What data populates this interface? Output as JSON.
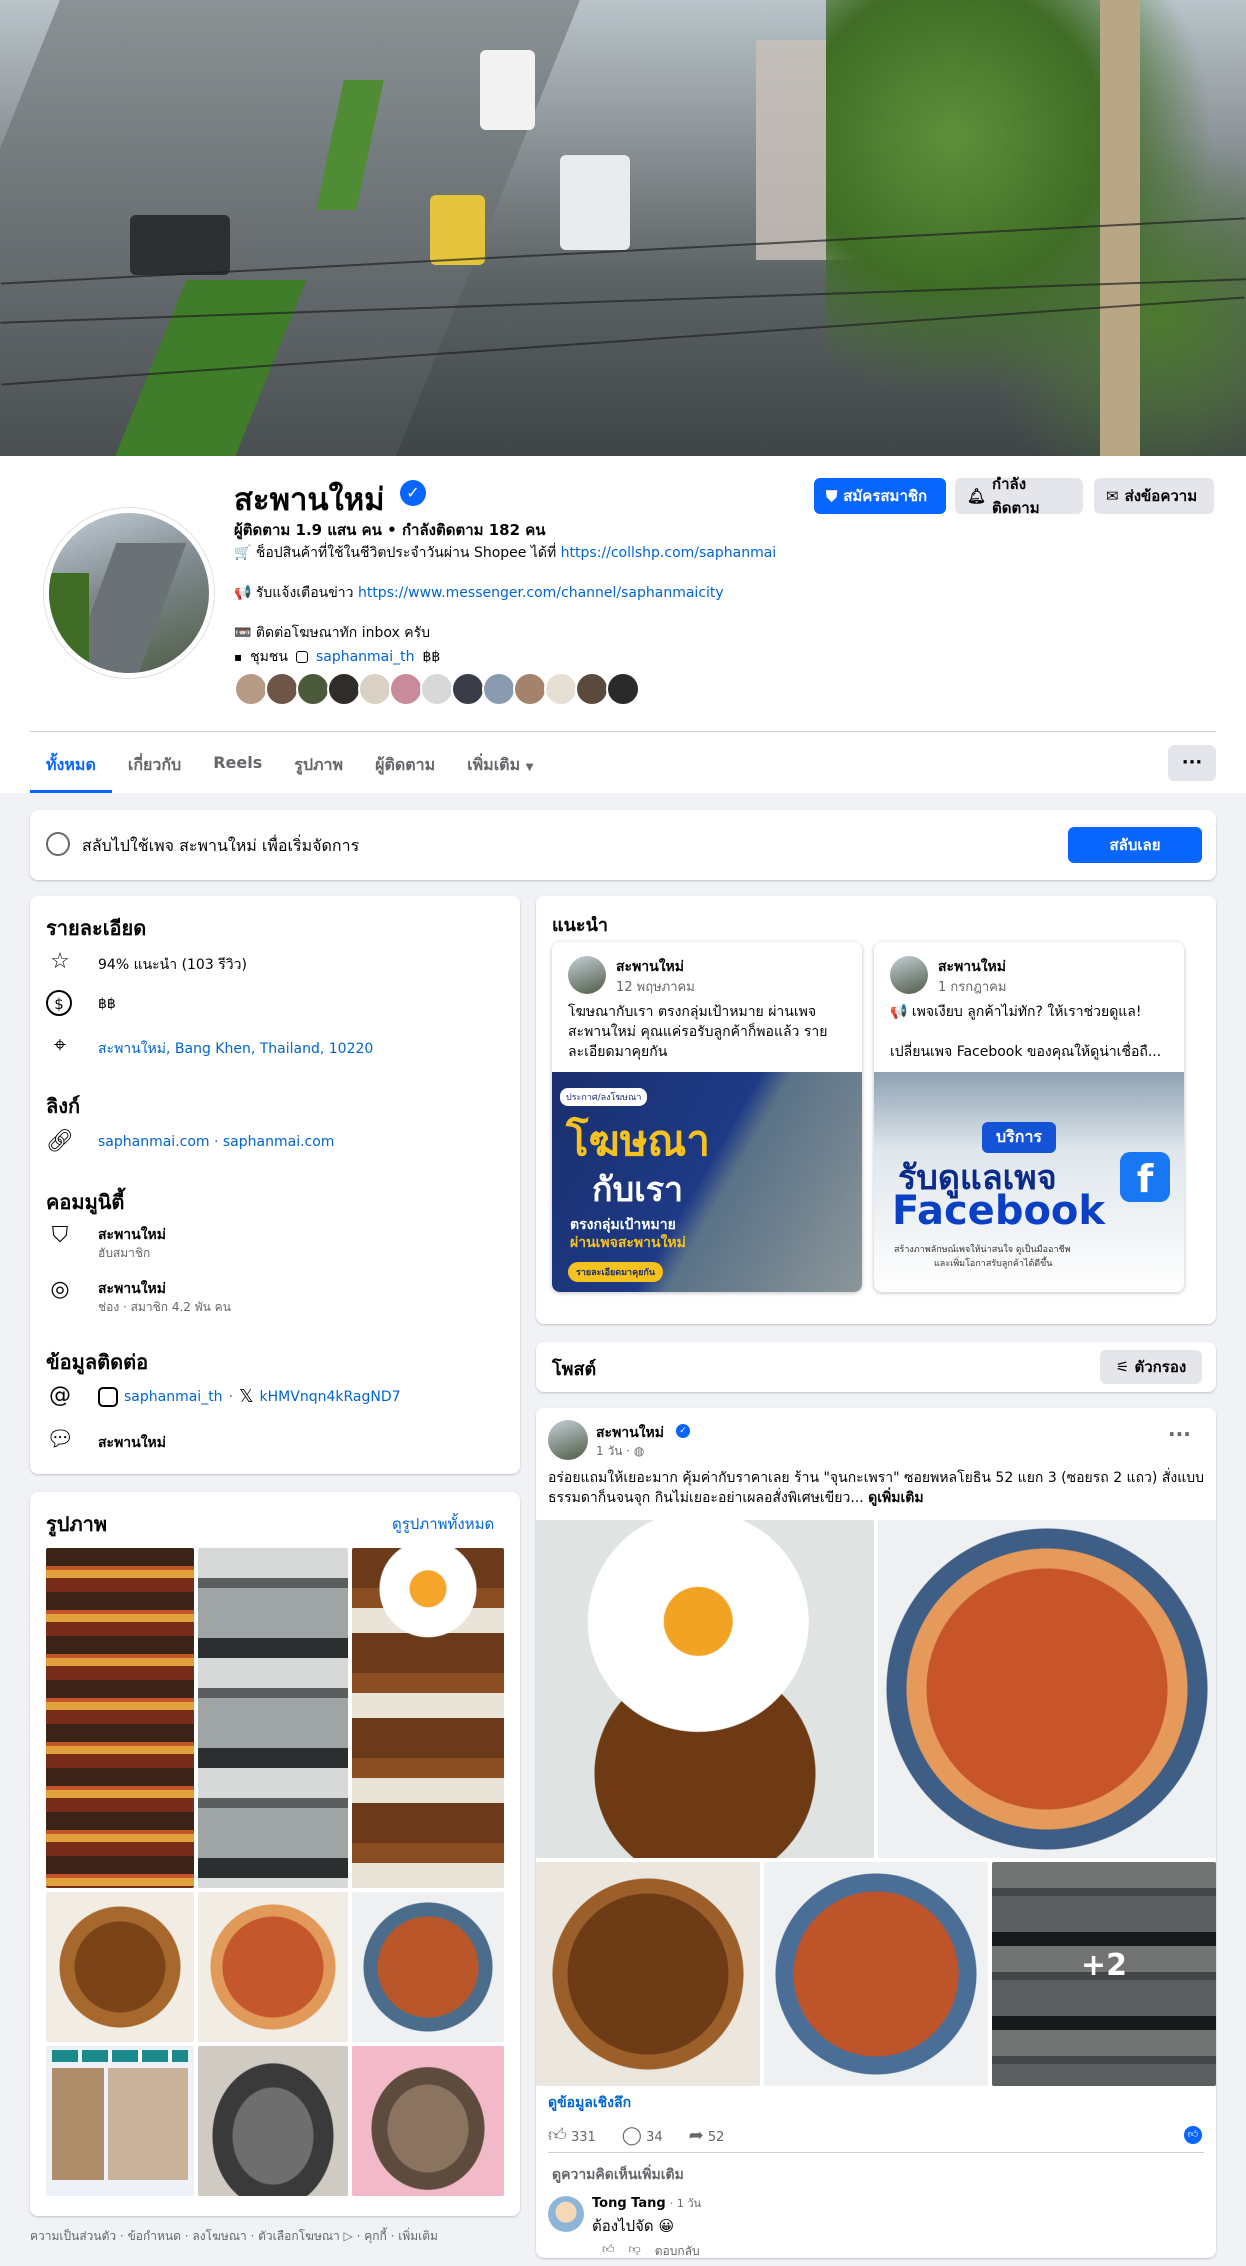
{
  "page": {
    "name": "สะพานใหม่",
    "stats": "ผู้ติดตาม 1.9 แสน คน • กำลังติดตาม 182 คน",
    "bio": {
      "shopee_text": "🛒 ช็อปสินค้าที่ใช้ในชีวิตประจำวันผ่าน Shopee ได้ที่ ",
      "shopee_link": "https://collshp.com/saphanmai",
      "channel_text": "📢 รับแจ้งเตือนข่าว ",
      "channel_link": "https://www.messenger.com/channel/saphanmaicity",
      "ads_text": "📼 ติดต่อโฆษณาทัก inbox ครับ",
      "category": "ชุมชน",
      "instagram": "saphanmai_th",
      "price": "฿฿"
    }
  },
  "header_buttons": {
    "join": "สมัครสมาชิก",
    "follow": "กำลังติดตาม",
    "message": "ส่งข้อความ"
  },
  "tabs": [
    "ทั้งหมด",
    "เกี่ยวกับ",
    "Reels",
    "รูปภาพ",
    "ผู้ติดตาม",
    "เพิ่มเติม"
  ],
  "switch_bar": {
    "text": "สลับไปใช้เพจ สะพานใหม่ เพื่อเริ่มจัดการ",
    "button": "สลับเลย"
  },
  "details": {
    "title": "รายละเอียด",
    "rating": "94% แนะนำ (103 รีวิว)",
    "price": "฿฿",
    "address": "สะพานใหม่, Bang Khen, Thailand, 10220",
    "links_title": "ลิงก์",
    "links": "saphanmai.com · saphanmai.com",
    "community_title": "คอมมูนิตี้",
    "community": [
      {
        "name": "สะพานใหม่",
        "sub": "ฮับสมาชิก"
      },
      {
        "name": "สะพานใหม่",
        "sub": "ช่อง · สมาชิก 4.2 พัน คน"
      }
    ],
    "contact_title": "ข้อมูลติดต่อ",
    "instagram": "saphanmai_th",
    "x_handle": "kHMVnqn4kRagND7",
    "messenger": "สะพานใหม่"
  },
  "photos": {
    "title": "รูปภาพ",
    "see_all": "ดูรูปภาพทั้งหมด"
  },
  "featured": {
    "title": "แนะนำ",
    "cards": [
      {
        "name": "สะพานใหม่",
        "date": "12 พฤษภาคม",
        "text": "โฆษณากับเรา ตรงกลุ่มเป้าหมาย ผ่านเพจ สะพานใหม่ คุณแค่รอรับลูกค้าก็พอแล้ว รายละเอียดมาคุยกัน",
        "img_headline": "โฆษณา",
        "img_headline2": "กับเรา",
        "img_sub": "ตรงกลุ่มเป้าหมาย",
        "img_sub2": "ผ่านเพจสะพานใหม่",
        "img_tag": "ประกาศ/ลงโฆษณา",
        "img_btn": "รายละเอียดมาคุยกัน"
      },
      {
        "name": "สะพานใหม่",
        "date": "1 กรกฎาคม",
        "text": "📢 เพจเงียบ ลูกค้าไม่ทัก? ให้เราช่วยดูแล!\n\nเปลี่ยนเพจ Facebook ของคุณให้ดูน่าเชื่อถื...",
        "img_tag": "บริการ",
        "img_headline": "รับดูแลเพจ",
        "img_headline2": "Facebook",
        "img_sub": "สร้างภาพลักษณ์เพจให้น่าสนใจ ดูเป็นมืออาชีพ",
        "img_sub2": "และเพิ่มโอกาสรับลูกค้าได้ดีขึ้น"
      }
    ]
  },
  "posts": {
    "title": "โพสต์",
    "filter": "ตัวกรอง"
  },
  "post": {
    "author": "สะพานใหม่",
    "time": "1 วัน",
    "text": "อร่อยแถมให้เยอะมาก คุ้มค่ากับราคาเลย ร้าน \"จุนกะเพรา\" ซอยพหลโยธิน 52 แยก 3 (ซอยรถ 2 แถว) สั่งแบบธรรมดาก็นจนจุก กินไม่เยอะอย่าเผลอสั่งพิเศษเขียว...",
    "see_more": "ดูเพิ่มเติม",
    "more_photos": "+2",
    "insights": "ดูข้อมูลเชิงลึก",
    "likes": "331",
    "comments": "34",
    "shares": "52",
    "view_more_comments": "ดูความคิดเห็นเพิ่มเติม",
    "comment": {
      "author": "Tong Tang",
      "time": "1 วัน",
      "text": "ต้องไปจัด 😀",
      "reply": "ตอบกลับ"
    }
  },
  "footer": "ความเป็นส่วนตัว · ข้อกำหนด · ลงโฆษณา · ตัวเลือกโฆษณา ▷ · คุกกี้ · เพิ่มเติม",
  "colors": {
    "brand_blue": "#0866ff",
    "link_blue": "#0064d1",
    "background": "#f0f2f5"
  }
}
